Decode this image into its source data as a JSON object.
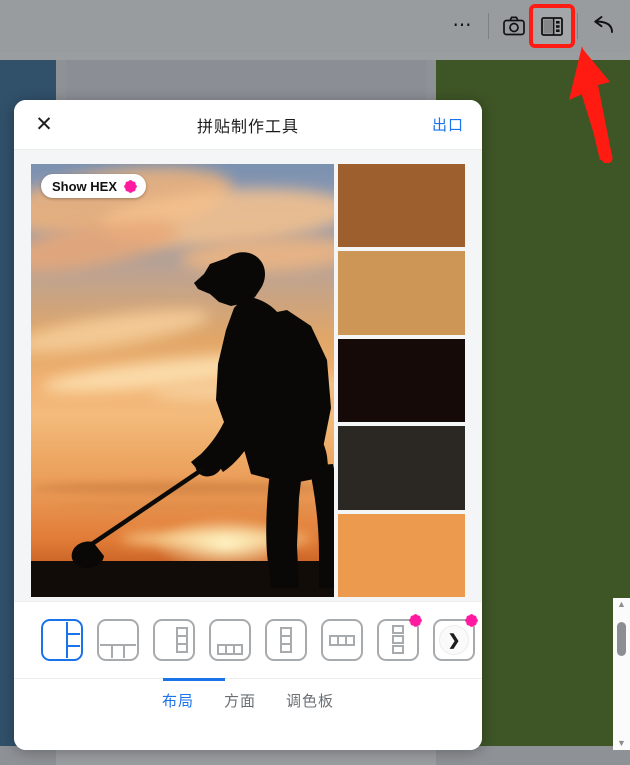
{
  "browser_toolbar": {
    "more_label": "⋯",
    "more_icon": "ellipsis-icon",
    "camera_icon": "camera-icon",
    "collage_icon": "collage-panel-icon",
    "undo_icon": "undo-arrow-icon",
    "highlight_color": "#ff1b12"
  },
  "modal": {
    "close_label": "✕",
    "title": "拼贴制作工具",
    "export_label": "出口"
  },
  "canvas": {
    "hex_button": {
      "label": "Show HEX",
      "icon": "flower-extension-icon",
      "icon_color": "#ff1aa0"
    },
    "photo": {
      "alt": "golfer-silhouette-sunset"
    },
    "swatches": [
      {
        "name": "swatch-brown",
        "hex": "#9E5F2E"
      },
      {
        "name": "swatch-tan",
        "hex": "#CD9657"
      },
      {
        "name": "swatch-near-black",
        "hex": "#150A07"
      },
      {
        "name": "swatch-dark-gray",
        "hex": "#2B2823"
      },
      {
        "name": "swatch-orange",
        "hex": "#EB9A4E"
      }
    ]
  },
  "layouts": [
    {
      "name": "layout-left-big-3-right",
      "selected": true,
      "badge": false,
      "kind": "left-big-3"
    },
    {
      "name": "layout-top-big-3-bottom",
      "selected": false,
      "badge": false,
      "kind": "top-big-3"
    },
    {
      "name": "layout-right-strip-3",
      "selected": false,
      "badge": false,
      "kind": "right-strip-3"
    },
    {
      "name": "layout-bottom-strip-3",
      "selected": false,
      "badge": false,
      "kind": "bottom-strip-3"
    },
    {
      "name": "layout-center-column-3",
      "selected": false,
      "badge": false,
      "kind": "center-col-3"
    },
    {
      "name": "layout-center-row-3",
      "selected": false,
      "badge": false,
      "kind": "center-row-3"
    },
    {
      "name": "layout-spaced-column-3",
      "selected": false,
      "badge": true,
      "kind": "spaced-col-3"
    },
    {
      "name": "layout-next-page",
      "selected": false,
      "badge": true,
      "kind": "next",
      "arrow": "❯"
    }
  ],
  "tabs": [
    {
      "name": "tab-layout",
      "label": "布局",
      "active": true
    },
    {
      "name": "tab-aspect",
      "label": "方面",
      "active": false
    },
    {
      "name": "tab-palette",
      "label": "调色板",
      "active": false
    }
  ],
  "scrollbar": {
    "up_arrow": "▲",
    "down_arrow": "▼"
  },
  "colors": {
    "accent": "#1a73e8",
    "badge_pink": "#ff1aa0",
    "bg_left_card": "#31506a",
    "bg_right_card": "#3e5526",
    "bg_gray": "#8e9196"
  }
}
